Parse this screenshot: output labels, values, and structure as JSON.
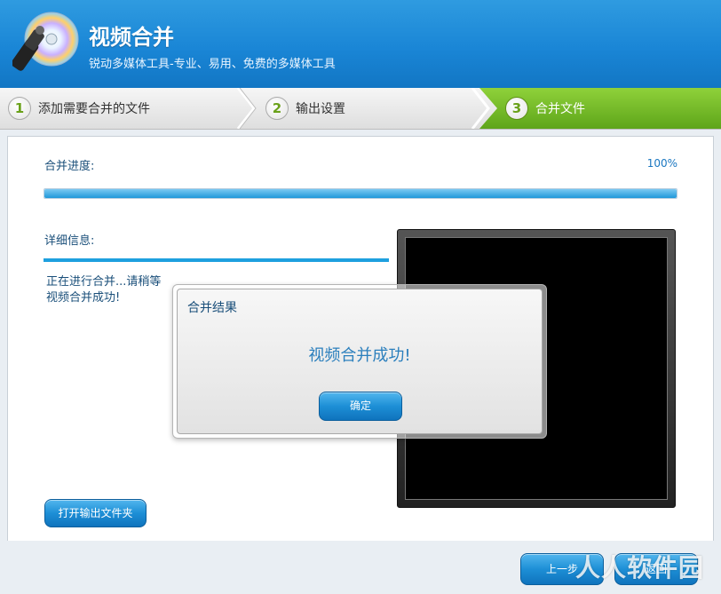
{
  "app": {
    "title": "视频合并",
    "subtitle": "锐动多媒体工具-专业、易用、免费的多媒体工具"
  },
  "steps": [
    {
      "num": "1",
      "label": "添加需要合并的文件"
    },
    {
      "num": "2",
      "label": "输出设置"
    },
    {
      "num": "3",
      "label": "合并文件"
    }
  ],
  "progress": {
    "label": "合并进度:",
    "percent_text": "100%",
    "value": 1.0
  },
  "details": {
    "label": "详细信息:",
    "lines": [
      "正在进行合并...请稍等",
      "视频合并成功!"
    ]
  },
  "buttons": {
    "open_folder": "打开输出文件夹",
    "prev": "上一步",
    "back": "返回"
  },
  "dialog": {
    "title": "合并结果",
    "message": "视频合并成功!",
    "ok": "确定"
  },
  "watermark": "人人软件园",
  "colors": {
    "header_blue": "#1a86d6",
    "active_step_green": "#6aa11a",
    "button_blue": "#1d8fd6"
  }
}
